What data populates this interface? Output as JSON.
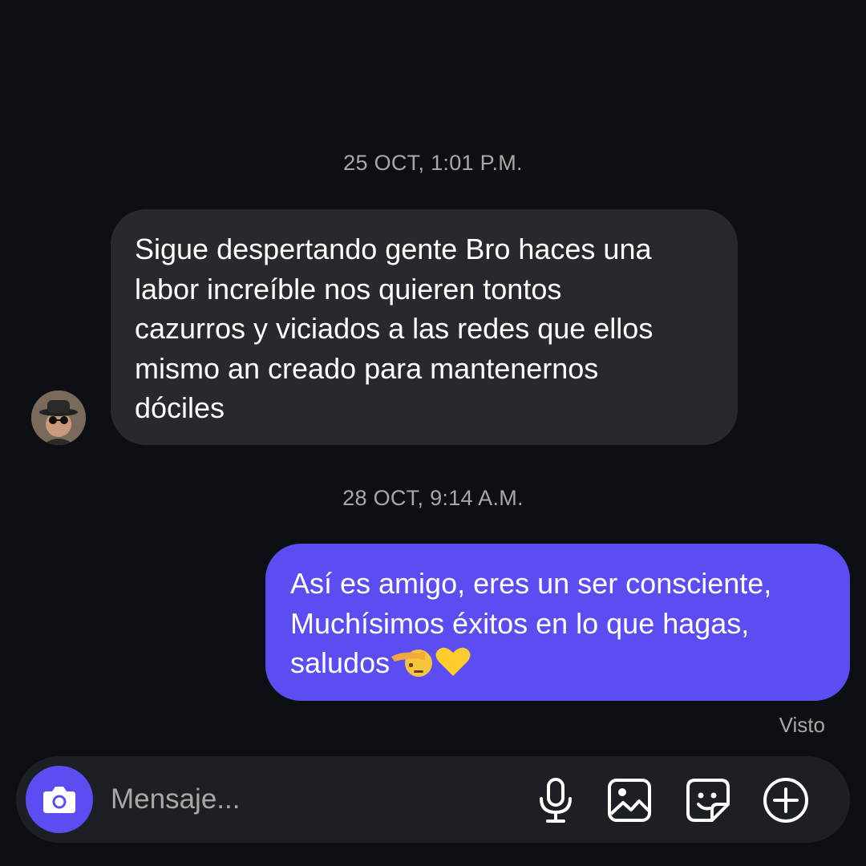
{
  "thread": {
    "messages": [
      {
        "timestamp": "25 OCT, 1:01 P.M.",
        "direction": "incoming",
        "lines": [
          "Sigue despertando gente Bro haces una",
          "labor increíble nos quieren tontos",
          "cazurros y viciados a las redes que ellos",
          "mismo an creado para mantenernos",
          "dóciles"
        ]
      },
      {
        "timestamp": "28 OCT, 9:14 A.M.",
        "direction": "outgoing",
        "lines": [
          "Así es amigo, eres un ser consciente,",
          "Muchísimos éxitos en lo que hagas,",
          "saludos"
        ],
        "emojis": [
          "saluting-face-emoji",
          "yellow-heart-emoji"
        ],
        "status": "Visto"
      }
    ]
  },
  "composer": {
    "placeholder": "Mensaje...",
    "icons": [
      "camera-icon",
      "microphone-icon",
      "gallery-icon",
      "sticker-icon",
      "plus-circle-icon"
    ]
  },
  "colors": {
    "background": "#0c1014",
    "incoming_bubble": "#262a2f",
    "outgoing_bubble": "#5b4df2",
    "accent": "#5b4df2",
    "muted_text": "#a8a8a8"
  }
}
